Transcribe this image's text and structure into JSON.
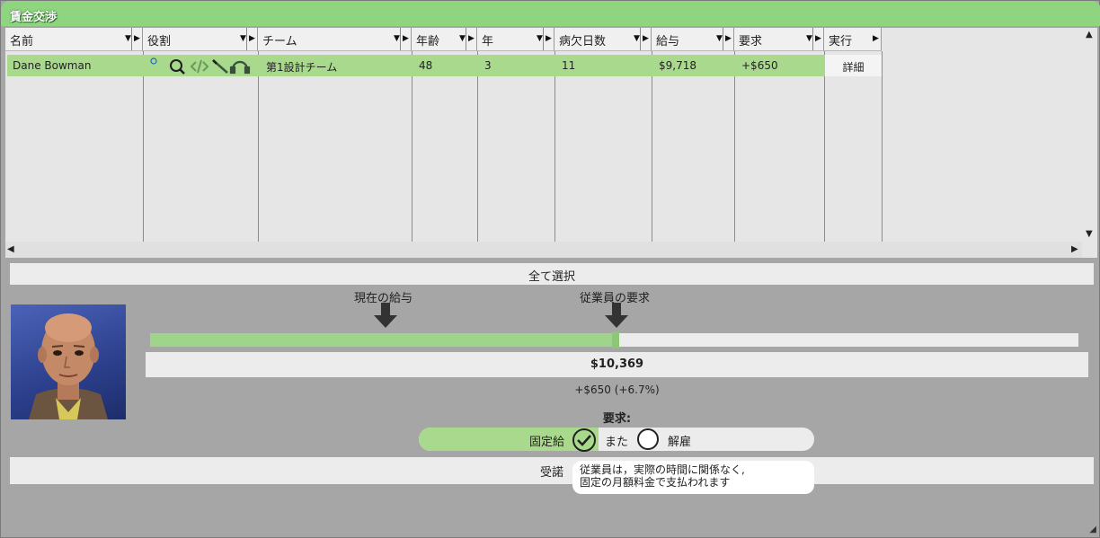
{
  "window": {
    "title": "賃金交渉"
  },
  "grid": {
    "columns": [
      "名前",
      "役割",
      "チーム",
      "年齢",
      "年",
      "病欠日数",
      "給与",
      "要求",
      "実行"
    ],
    "row": {
      "name": "Dane Bowman",
      "team": "第1設計チーム",
      "age": "48",
      "years": "3",
      "sick_days": "11",
      "salary": "$9,718",
      "demand": "+$650",
      "action": "詳細"
    }
  },
  "select_all": "全て選択",
  "negotiation": {
    "current_label": "現在の給与",
    "employee_label": "従業員の要求",
    "bar_fill_fraction": 0.5,
    "amount": "$10,369",
    "diff": "+$650 (+6.7%)",
    "demand_heading": "要求:",
    "option_fixed": "固定給",
    "option_or": "また",
    "option_fire": "解雇",
    "accept": "受諾",
    "tooltip_line1": "従業員は，実際の時間に関係なく,",
    "tooltip_line2": "固定の月額料金で支払われます"
  },
  "colors": {
    "accent": "#8fd57f",
    "row_select": "#a9d98c"
  },
  "icons": [
    "search-icon",
    "code-icon",
    "pencil-icon",
    "headset-icon",
    "check-icon"
  ]
}
